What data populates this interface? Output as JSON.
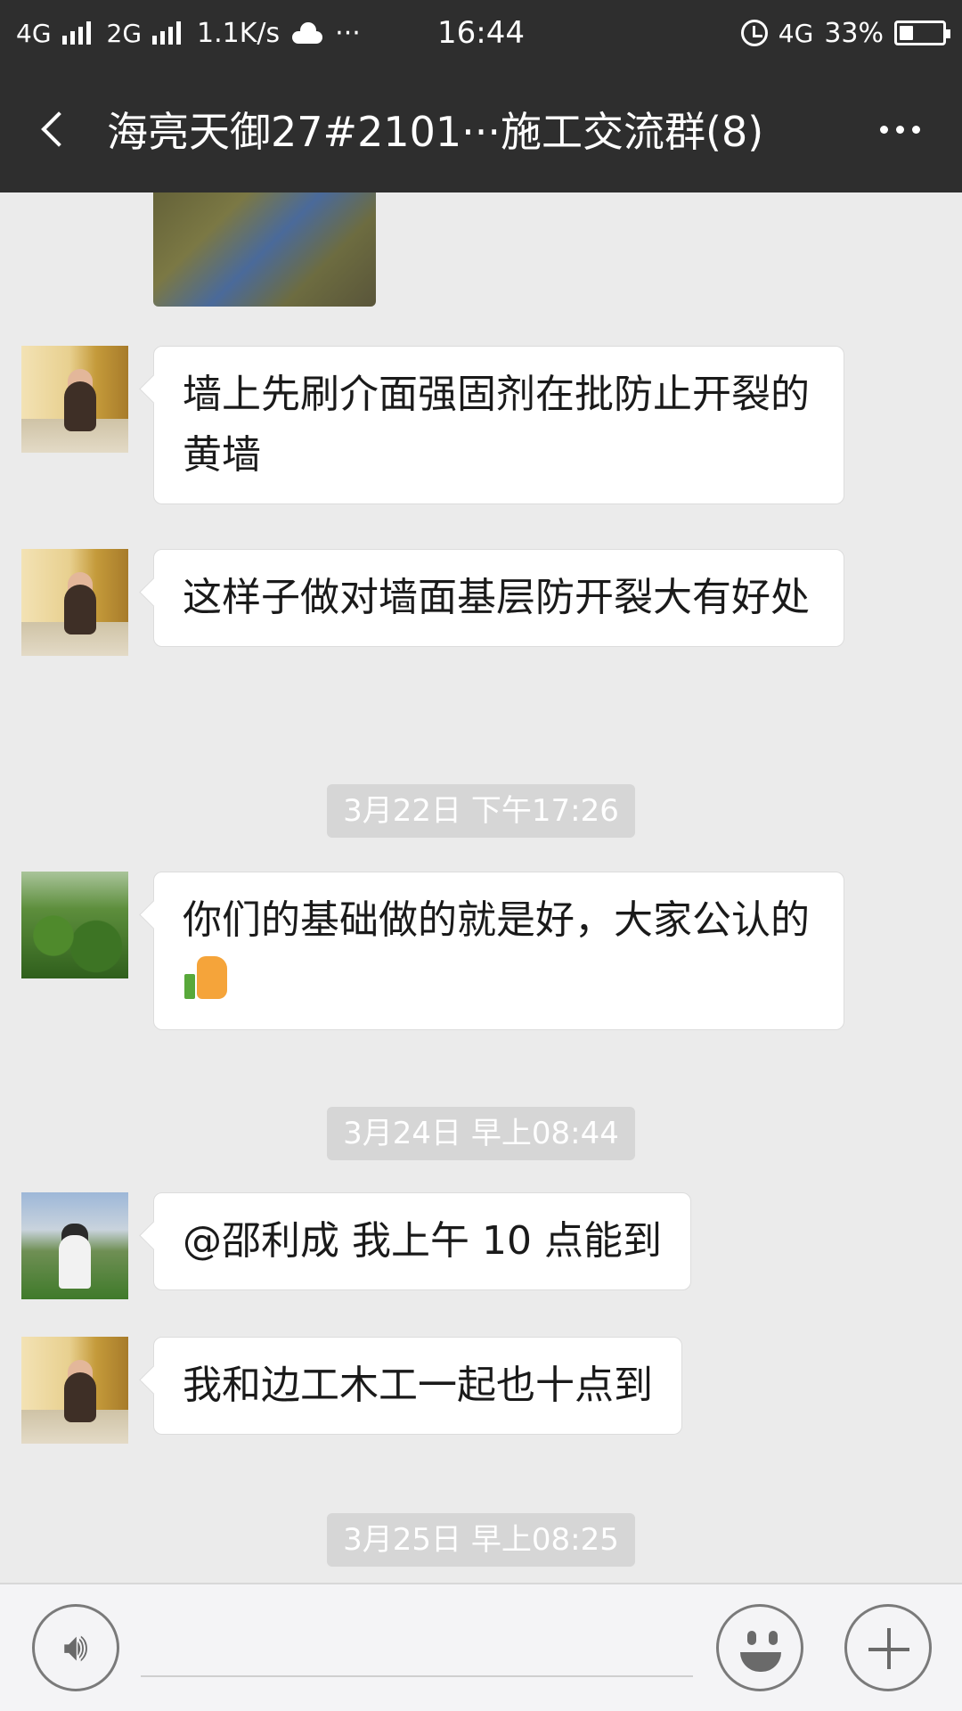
{
  "status_bar": {
    "network_1": "4G",
    "network_2": "2G",
    "speed": "1.1K/s",
    "overflow": "···",
    "time": "16:44",
    "network_right": "4G",
    "battery": "33%"
  },
  "header": {
    "title": "海亮天御27#2101···施工交流群(8)"
  },
  "messages": [
    {
      "text": "墙上先刷介面强固剂在批防止开裂的黄墙"
    },
    {
      "text": "这样子做对墙面基层防开裂大有好处"
    },
    {
      "timestamp": "3月22日 下午17:26"
    },
    {
      "text": "你们的基础做的就是好，大家公认的"
    },
    {
      "timestamp": "3月24日 早上08:44"
    },
    {
      "text": "@邵利成  我上午 10 点能到"
    },
    {
      "text": "我和边工木工一起也十点到"
    },
    {
      "timestamp": "3月25日 早上08:25"
    }
  ],
  "icons": {
    "back": "back-arrow-icon",
    "more": "more-icon",
    "voice": "voice-icon",
    "emoji": "emoji-icon",
    "plus": "plus-icon",
    "thumbs_up": "thumbs-up-icon"
  },
  "colors": {
    "header_bg": "#2e2e2e",
    "chat_bg": "#ebebeb",
    "bubble_bg": "#ffffff",
    "timestamp_bg": "#d6d6d6"
  }
}
